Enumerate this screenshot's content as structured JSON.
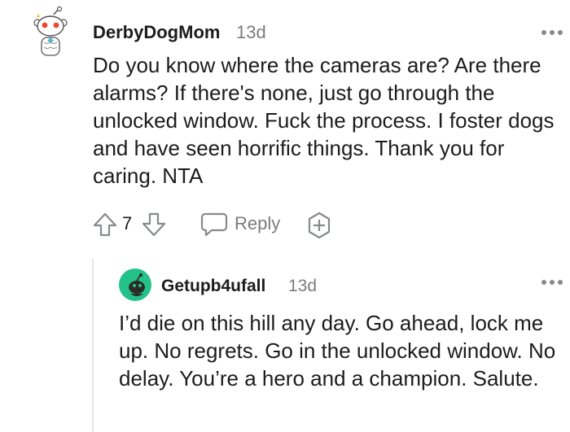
{
  "comments": [
    {
      "username": "DerbyDogMom",
      "age": "13d",
      "body": "Do you know where the cameras are? Are there alarms? If there's none, just go through the unlocked window. Fuck the process. I foster dogs and have seen horrific things. Thank you for caring. NTA",
      "votes": "7",
      "reply_label": "Reply"
    },
    {
      "username": "Getupb4ufall",
      "age": "13d",
      "body": "I’d die on this hill any day. Go ahead, lock me up. No regrets. Go in the unlocked window. No delay. You’re a hero and a champion. Salute."
    }
  ],
  "icons": {
    "upvote": "upvote-arrow-icon",
    "downvote": "downvote-arrow-icon",
    "reply": "speech-bubble-icon",
    "award": "award-plus-icon",
    "more": "more-options-icon"
  },
  "colors": {
    "text": "#1c1c1c",
    "meta": "#7c7c7c",
    "icon": "#878a8c",
    "avatar2_bg": "#24c28a"
  }
}
